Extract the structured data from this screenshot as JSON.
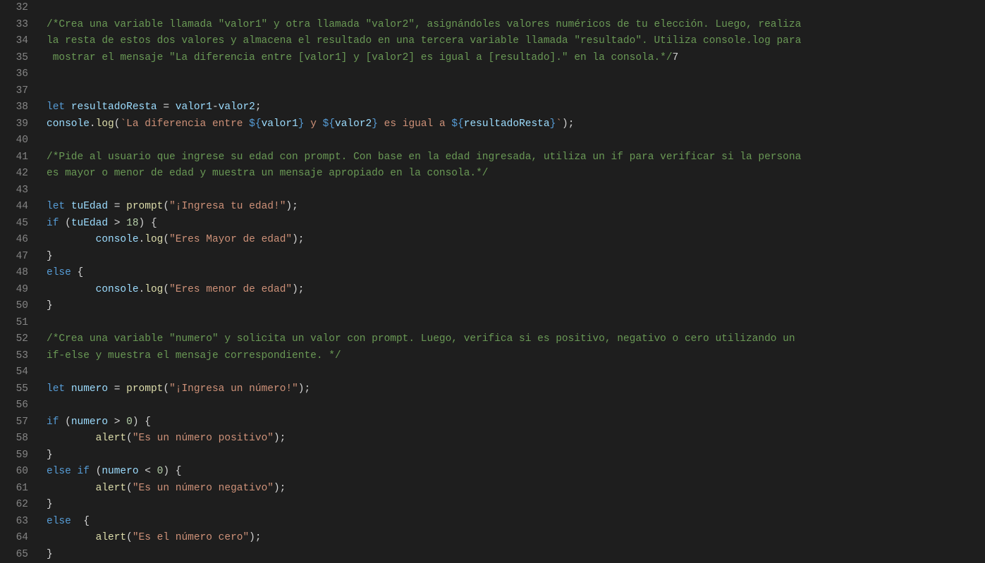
{
  "editor": {
    "startLine": 32,
    "lines": [
      {
        "num": 32,
        "tokens": []
      },
      {
        "num": 33,
        "tokens": [
          {
            "cls": "c-comment",
            "t": "/*Crea una variable llamada \"valor1\" y otra llamada \"valor2\", asignándoles valores numéricos de tu elección. Luego, realiza"
          }
        ]
      },
      {
        "num": 34,
        "tokens": [
          {
            "cls": "c-comment",
            "t": "la resta de estos dos valores y almacena el resultado en una tercera variable llamada \"resultado\". Utiliza console.log para"
          }
        ]
      },
      {
        "num": 35,
        "tokens": [
          {
            "cls": "c-comment",
            "t": " mostrar el mensaje \"La diferencia entre [valor1] y [valor2] es igual a [resultado].\" en la consola.*/"
          },
          {
            "cls": "c-punct",
            "t": "7"
          }
        ]
      },
      {
        "num": 36,
        "tokens": []
      },
      {
        "num": 37,
        "tokens": []
      },
      {
        "num": 38,
        "tokens": [
          {
            "cls": "c-keyword",
            "t": "let"
          },
          {
            "cls": "c-punct",
            "t": " "
          },
          {
            "cls": "c-var",
            "t": "resultadoResta"
          },
          {
            "cls": "c-punct",
            "t": " = "
          },
          {
            "cls": "c-var",
            "t": "valor1"
          },
          {
            "cls": "c-punct",
            "t": "-"
          },
          {
            "cls": "c-var",
            "t": "valor2"
          },
          {
            "cls": "c-punct",
            "t": ";"
          }
        ]
      },
      {
        "num": 39,
        "tokens": [
          {
            "cls": "c-obj",
            "t": "console"
          },
          {
            "cls": "c-punct",
            "t": "."
          },
          {
            "cls": "c-func",
            "t": "log"
          },
          {
            "cls": "c-punct",
            "t": "("
          },
          {
            "cls": "c-string",
            "t": "`La diferencia entre "
          },
          {
            "cls": "c-tmpl",
            "t": "${"
          },
          {
            "cls": "c-var",
            "t": "valor1"
          },
          {
            "cls": "c-tmpl",
            "t": "}"
          },
          {
            "cls": "c-string",
            "t": " y "
          },
          {
            "cls": "c-tmpl",
            "t": "${"
          },
          {
            "cls": "c-var",
            "t": "valor2"
          },
          {
            "cls": "c-tmpl",
            "t": "}"
          },
          {
            "cls": "c-string",
            "t": " es igual a "
          },
          {
            "cls": "c-tmpl",
            "t": "${"
          },
          {
            "cls": "c-var",
            "t": "resultadoResta"
          },
          {
            "cls": "c-tmpl",
            "t": "}"
          },
          {
            "cls": "c-string",
            "t": "`"
          },
          {
            "cls": "c-punct",
            "t": ");"
          }
        ]
      },
      {
        "num": 40,
        "tokens": []
      },
      {
        "num": 41,
        "tokens": [
          {
            "cls": "c-comment",
            "t": "/*Pide al usuario que ingrese su edad con prompt. Con base en la edad ingresada, utiliza un if para verificar si la persona"
          }
        ]
      },
      {
        "num": 42,
        "tokens": [
          {
            "cls": "c-comment",
            "t": "es mayor o menor de edad y muestra un mensaje apropiado en la consola.*/"
          }
        ]
      },
      {
        "num": 43,
        "tokens": []
      },
      {
        "num": 44,
        "tokens": [
          {
            "cls": "c-keyword",
            "t": "let"
          },
          {
            "cls": "c-punct",
            "t": " "
          },
          {
            "cls": "c-var",
            "t": "tuEdad"
          },
          {
            "cls": "c-punct",
            "t": " = "
          },
          {
            "cls": "c-func",
            "t": "prompt"
          },
          {
            "cls": "c-punct",
            "t": "("
          },
          {
            "cls": "c-string",
            "t": "\"¡Ingresa tu edad!\""
          },
          {
            "cls": "c-punct",
            "t": ");"
          }
        ]
      },
      {
        "num": 45,
        "tokens": [
          {
            "cls": "c-keyword",
            "t": "if"
          },
          {
            "cls": "c-punct",
            "t": " ("
          },
          {
            "cls": "c-var",
            "t": "tuEdad"
          },
          {
            "cls": "c-punct",
            "t": " > "
          },
          {
            "cls": "c-num",
            "t": "18"
          },
          {
            "cls": "c-punct",
            "t": ") {"
          }
        ]
      },
      {
        "num": 46,
        "indent": 2,
        "tokens": [
          {
            "cls": "c-punct",
            "t": "        "
          },
          {
            "cls": "c-obj",
            "t": "console"
          },
          {
            "cls": "c-punct",
            "t": "."
          },
          {
            "cls": "c-func",
            "t": "log"
          },
          {
            "cls": "c-punct",
            "t": "("
          },
          {
            "cls": "c-string",
            "t": "\"Eres Mayor de edad\""
          },
          {
            "cls": "c-punct",
            "t": ");"
          }
        ]
      },
      {
        "num": 47,
        "tokens": [
          {
            "cls": "c-punct",
            "t": "}"
          }
        ]
      },
      {
        "num": 48,
        "tokens": [
          {
            "cls": "c-keyword",
            "t": "else"
          },
          {
            "cls": "c-punct",
            "t": " {"
          }
        ]
      },
      {
        "num": 49,
        "indent": 2,
        "tokens": [
          {
            "cls": "c-punct",
            "t": "        "
          },
          {
            "cls": "c-obj",
            "t": "console"
          },
          {
            "cls": "c-punct",
            "t": "."
          },
          {
            "cls": "c-func",
            "t": "log"
          },
          {
            "cls": "c-punct",
            "t": "("
          },
          {
            "cls": "c-string",
            "t": "\"Eres menor de edad\""
          },
          {
            "cls": "c-punct",
            "t": ");"
          }
        ]
      },
      {
        "num": 50,
        "tokens": [
          {
            "cls": "c-punct",
            "t": "}"
          }
        ]
      },
      {
        "num": 51,
        "tokens": []
      },
      {
        "num": 52,
        "tokens": [
          {
            "cls": "c-comment",
            "t": "/*Crea una variable \"numero\" y solicita un valor con prompt. Luego, verifica si es positivo, negativo o cero utilizando un"
          }
        ]
      },
      {
        "num": 53,
        "tokens": [
          {
            "cls": "c-comment",
            "t": "if-else y muestra el mensaje correspondiente. */"
          }
        ]
      },
      {
        "num": 54,
        "tokens": []
      },
      {
        "num": 55,
        "tokens": [
          {
            "cls": "c-keyword",
            "t": "let"
          },
          {
            "cls": "c-punct",
            "t": " "
          },
          {
            "cls": "c-var",
            "t": "numero"
          },
          {
            "cls": "c-punct",
            "t": " = "
          },
          {
            "cls": "c-func",
            "t": "prompt"
          },
          {
            "cls": "c-punct",
            "t": "("
          },
          {
            "cls": "c-string",
            "t": "\"¡Ingresa un número!\""
          },
          {
            "cls": "c-punct",
            "t": ");"
          }
        ]
      },
      {
        "num": 56,
        "tokens": []
      },
      {
        "num": 57,
        "tokens": [
          {
            "cls": "c-keyword",
            "t": "if"
          },
          {
            "cls": "c-punct",
            "t": " ("
          },
          {
            "cls": "c-var",
            "t": "numero"
          },
          {
            "cls": "c-punct",
            "t": " > "
          },
          {
            "cls": "c-num",
            "t": "0"
          },
          {
            "cls": "c-punct",
            "t": ") {"
          }
        ]
      },
      {
        "num": 58,
        "indent": 2,
        "tokens": [
          {
            "cls": "c-punct",
            "t": "        "
          },
          {
            "cls": "c-func",
            "t": "alert"
          },
          {
            "cls": "c-punct",
            "t": "("
          },
          {
            "cls": "c-string",
            "t": "\"Es un número positivo\""
          },
          {
            "cls": "c-punct",
            "t": ");"
          }
        ]
      },
      {
        "num": 59,
        "tokens": [
          {
            "cls": "c-punct",
            "t": "}"
          }
        ]
      },
      {
        "num": 60,
        "tokens": [
          {
            "cls": "c-keyword",
            "t": "else"
          },
          {
            "cls": "c-punct",
            "t": " "
          },
          {
            "cls": "c-keyword",
            "t": "if"
          },
          {
            "cls": "c-punct",
            "t": " ("
          },
          {
            "cls": "c-var",
            "t": "numero"
          },
          {
            "cls": "c-punct",
            "t": " < "
          },
          {
            "cls": "c-num",
            "t": "0"
          },
          {
            "cls": "c-punct",
            "t": ") {"
          }
        ]
      },
      {
        "num": 61,
        "indent": 2,
        "tokens": [
          {
            "cls": "c-punct",
            "t": "        "
          },
          {
            "cls": "c-func",
            "t": "alert"
          },
          {
            "cls": "c-punct",
            "t": "("
          },
          {
            "cls": "c-string",
            "t": "\"Es un número negativo\""
          },
          {
            "cls": "c-punct",
            "t": ");"
          }
        ]
      },
      {
        "num": 62,
        "tokens": [
          {
            "cls": "c-punct",
            "t": "}"
          }
        ]
      },
      {
        "num": 63,
        "tokens": [
          {
            "cls": "c-keyword",
            "t": "else"
          },
          {
            "cls": "c-punct",
            "t": "  {"
          }
        ]
      },
      {
        "num": 64,
        "indent": 2,
        "tokens": [
          {
            "cls": "c-punct",
            "t": "        "
          },
          {
            "cls": "c-func",
            "t": "alert"
          },
          {
            "cls": "c-punct",
            "t": "("
          },
          {
            "cls": "c-string",
            "t": "\"Es el número cero\""
          },
          {
            "cls": "c-punct",
            "t": ");"
          }
        ]
      },
      {
        "num": 65,
        "tokens": [
          {
            "cls": "c-punct",
            "t": "}"
          }
        ]
      }
    ]
  }
}
